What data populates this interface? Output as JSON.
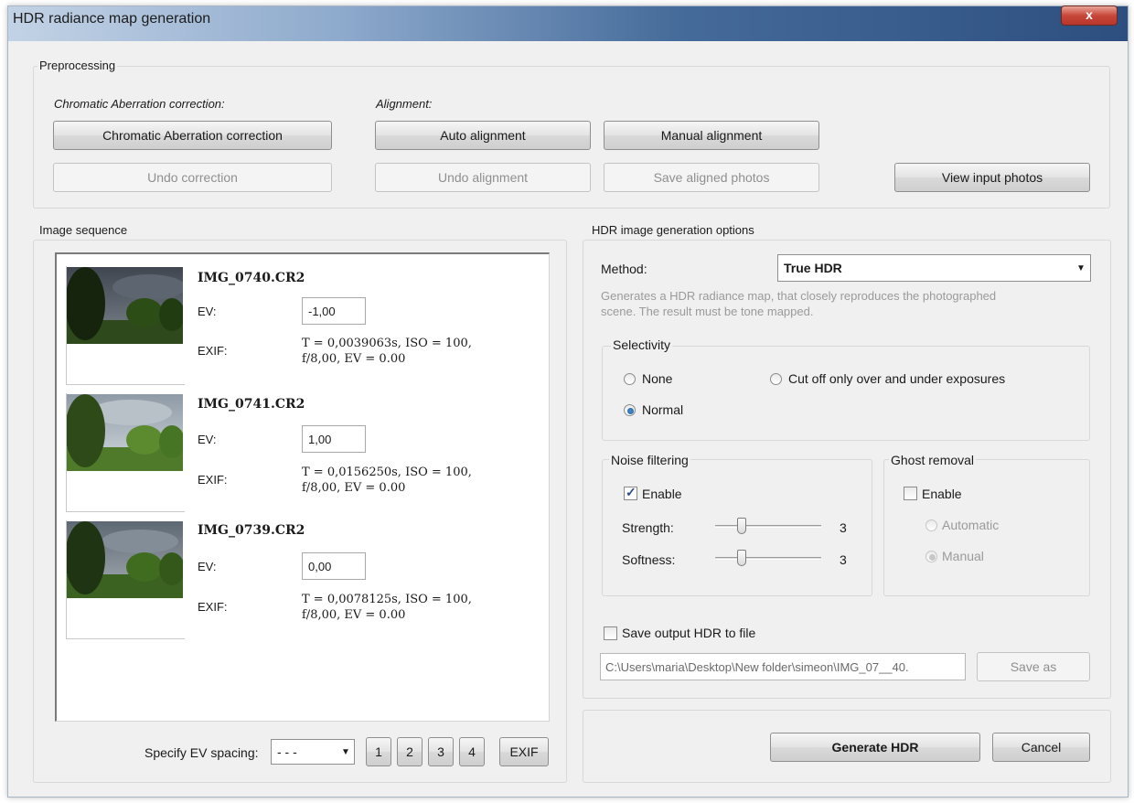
{
  "window": {
    "title": "HDR radiance map generation",
    "close_glyph": "x"
  },
  "preprocessing": {
    "label": "Preprocessing",
    "ca_heading": "Chromatic Aberration correction:",
    "alignment_heading": "Alignment:",
    "ca_button": "Chromatic Aberration correction",
    "undo_correction": "Undo correction",
    "auto_alignment": "Auto alignment",
    "manual_alignment": "Manual alignment",
    "undo_alignment": "Undo alignment",
    "save_aligned": "Save aligned photos",
    "view_input": "View input photos"
  },
  "sequence": {
    "label": "Image sequence",
    "ev_label": "EV:",
    "exif_label": "EXIF:",
    "items": [
      {
        "name": "IMG_0740.CR2",
        "ev": "-1,00",
        "exif_line1": "T = 0,0039063s, ISO = 100,",
        "exif_line2": "f/8,00, EV = 0.00"
      },
      {
        "name": "IMG_0741.CR2",
        "ev": "1,00",
        "exif_line1": "T = 0,0156250s, ISO = 100,",
        "exif_line2": "f/8,00, EV = 0.00"
      },
      {
        "name": "IMG_0739.CR2",
        "ev": "0,00",
        "exif_line1": "T = 0,0078125s, ISO = 100,",
        "exif_line2": "f/8,00, EV = 0.00"
      }
    ],
    "spacing_label": "Specify EV spacing:",
    "spacing_value": "- - -",
    "spacing_buttons": [
      "1",
      "2",
      "3",
      "4"
    ],
    "exif_button": "EXIF"
  },
  "options": {
    "label": "HDR image generation options",
    "method_label": "Method:",
    "method_value": "True HDR",
    "description_line1": "Generates a HDR radiance map, that closely reproduces the photographed",
    "description_line2": "scene. The result must be tone mapped.",
    "selectivity": {
      "label": "Selectivity",
      "none": "None",
      "normal": "Normal",
      "cutoff": "Cut off only over and under exposures",
      "selected": "Normal"
    },
    "noise": {
      "label": "Noise filtering",
      "enable": "Enable",
      "enabled": true,
      "strength_label": "Strength:",
      "strength_value": "3",
      "softness_label": "Softness:",
      "softness_value": "3"
    },
    "ghost": {
      "label": "Ghost removal",
      "enable": "Enable",
      "enabled": false,
      "automatic": "Automatic",
      "manual": "Manual",
      "selected": "Manual"
    },
    "save_output_label": "Save output HDR to file",
    "save_output_checked": false,
    "output_path": "C:\\Users\\maria\\Desktop\\New folder\\simeon\\IMG_07__40.",
    "save_as": "Save as"
  },
  "actions": {
    "generate": "Generate HDR",
    "cancel": "Cancel"
  },
  "colors": {
    "title_gradient_end": "#2d4f7f",
    "window_bg": "#f0f0f0",
    "radio_dot": "#1d5c9a"
  }
}
